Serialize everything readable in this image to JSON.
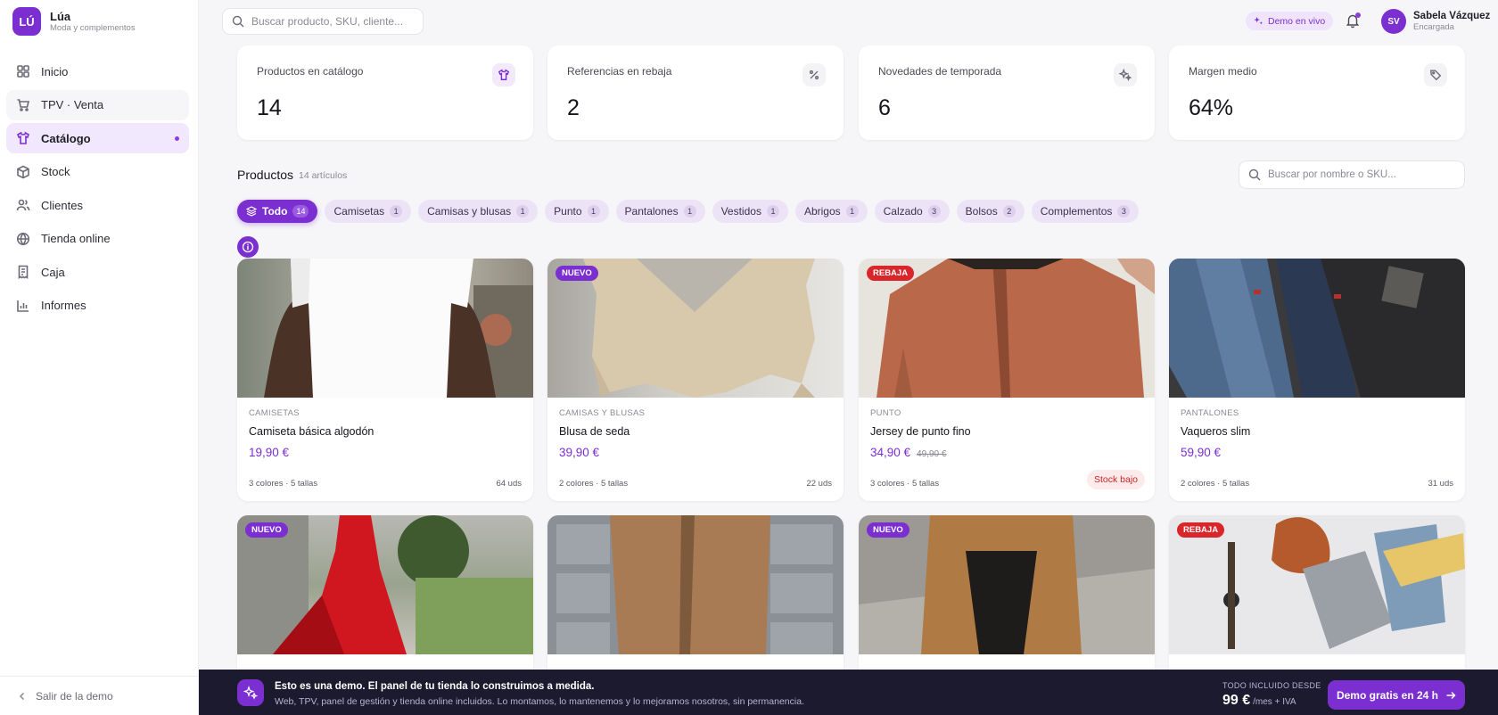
{
  "brand": {
    "logo": "LÚ",
    "name": "Lúa",
    "subtitle": "Moda y complementos"
  },
  "sidebar": {
    "items": [
      {
        "label": "Inicio",
        "icon": "grid-icon"
      },
      {
        "label": "TPV · Venta",
        "icon": "cart-icon"
      },
      {
        "label": "Catálogo",
        "icon": "shirt-icon",
        "active": true
      },
      {
        "label": "Stock",
        "icon": "box-icon"
      },
      {
        "label": "Clientes",
        "icon": "users-icon"
      },
      {
        "label": "Tienda online",
        "icon": "globe-icon"
      },
      {
        "label": "Caja",
        "icon": "receipt-icon"
      },
      {
        "label": "Informes",
        "icon": "bar-chart-icon"
      }
    ],
    "exit_label": "Salir de la demo"
  },
  "topbar": {
    "search_placeholder": "Buscar producto, SKU, cliente...",
    "demo_label": "Demo en vivo",
    "user": {
      "initials": "SV",
      "name": "Sabela Vázquez",
      "role": "Encargada"
    }
  },
  "stats": [
    {
      "label": "Productos en catálogo",
      "value": "14",
      "icon": "shirt-icon"
    },
    {
      "label": "Referencias en rebaja",
      "value": "2",
      "icon": "percent-icon"
    },
    {
      "label": "Novedades de temporada",
      "value": "6",
      "icon": "sparkles-icon"
    },
    {
      "label": "Margen medio",
      "value": "64%",
      "icon": "tag-icon"
    }
  ],
  "products_section": {
    "title": "Productos",
    "count": "14 artículos",
    "search_placeholder": "Buscar por nombre o SKU...",
    "filters": [
      {
        "label": "Todo",
        "count": "14"
      },
      {
        "label": "Camisetas",
        "count": "1"
      },
      {
        "label": "Camisas y blusas",
        "count": "1"
      },
      {
        "label": "Punto",
        "count": "1"
      },
      {
        "label": "Pantalones",
        "count": "1"
      },
      {
        "label": "Vestidos",
        "count": "1"
      },
      {
        "label": "Abrigos",
        "count": "1"
      },
      {
        "label": "Calzado",
        "count": "3"
      },
      {
        "label": "Bolsos",
        "count": "2"
      },
      {
        "label": "Complementos",
        "count": "3"
      }
    ],
    "products": [
      {
        "category": "CAMISETAS",
        "name": "Camiseta básica algodón",
        "price": "19,90 €",
        "variants": "3 colores · 5 tallas",
        "units": "64 uds"
      },
      {
        "badge": "NUEVO",
        "category": "CAMISAS Y BLUSAS",
        "name": "Blusa de seda",
        "price": "39,90 €",
        "variants": "2 colores · 5 tallas",
        "units": "22 uds"
      },
      {
        "badge": "REBAJA",
        "category": "PUNTO",
        "name": "Jersey de punto fino",
        "price": "34,90 €",
        "old_price": "49,90 €",
        "variants": "3 colores · 5 tallas",
        "stock_label": "Stock bajo"
      },
      {
        "category": "PANTALONES",
        "name": "Vaqueros slim",
        "price": "59,90 €",
        "variants": "2 colores · 5 tallas",
        "units": "31 uds"
      },
      {
        "badge": "NUEVO"
      },
      {},
      {
        "badge": "NUEVO"
      },
      {
        "badge": "REBAJA"
      }
    ]
  },
  "banner": {
    "title": "Esto es una demo. El panel de tu tienda lo construimos a medida.",
    "subtitle": "Web, TPV, panel de gestión y tienda online incluidos. Lo montamos, lo mantenemos y lo mejoramos nosotros, sin permanencia.",
    "price_label": "TODO INCLUIDO DESDE",
    "price": "99 €",
    "price_suffix": "/mes + IVA",
    "cta": "Demo gratis en 24 h"
  },
  "colors": {
    "accent": "#7b2fd0",
    "sale": "#d9262a",
    "banner_bg": "#1b1a2e"
  }
}
